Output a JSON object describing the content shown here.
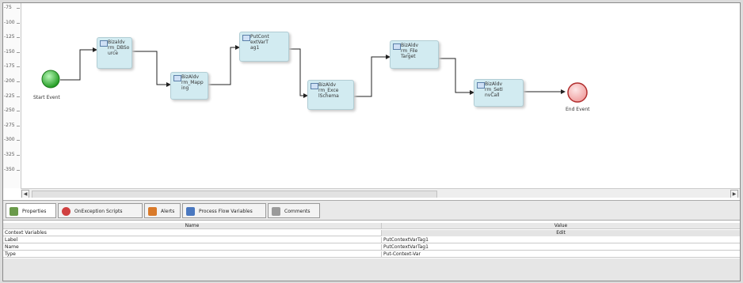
{
  "ruler": {
    "ticks": [
      "-75",
      "-100",
      "-125",
      "-150",
      "-175",
      "-200",
      "-225",
      "-250",
      "-275",
      "-300",
      "-325",
      "-350"
    ]
  },
  "flow": {
    "start_label": "Start Event",
    "end_label": "End Event",
    "nodes": [
      {
        "id": "n1",
        "text": "Bizaldv\nrm_DBSo\nurce",
        "icon": "db-source-icon"
      },
      {
        "id": "n2",
        "text": "BizAldv\nrm_Mapp\ning",
        "icon": "mapping-icon"
      },
      {
        "id": "n3",
        "text": "PutCont\nextVarT\nag1",
        "icon": "put-context-var-icon"
      },
      {
        "id": "n4",
        "text": "BizAldv\nrm_Exce\nlSchema",
        "icon": "excel-schema-icon"
      },
      {
        "id": "n5",
        "text": "BizAldv\nrm_File\nTarget",
        "icon": "file-target-icon"
      },
      {
        "id": "n6",
        "text": "BizAldv\nrm_SetI\nnvCall",
        "icon": "set-inv-call-icon"
      }
    ]
  },
  "tabs": [
    {
      "label": "Properties",
      "active": true,
      "icon": "properties-icon",
      "color": "#6a9a4a"
    },
    {
      "label": "OnException Scripts",
      "active": false,
      "icon": "exception-script-icon",
      "color": "#d04040"
    },
    {
      "label": "Alerts",
      "active": false,
      "icon": "alerts-icon",
      "color": "#d97a2a"
    },
    {
      "label": "Process Flow Variables",
      "active": false,
      "icon": "process-variables-icon",
      "color": "#4a78c0"
    },
    {
      "label": "Comments",
      "active": false,
      "icon": "comments-icon",
      "color": "#9a9a9a"
    }
  ],
  "properties": {
    "col_name": "Name",
    "col_value": "Value",
    "rows": [
      {
        "name": "Context Variables",
        "value": "Edit"
      },
      {
        "name": "Label",
        "value": "PutContextVarTag1"
      },
      {
        "name": "Name",
        "value": "PutContextVarTag1"
      },
      {
        "name": "Type",
        "value": "Put-Context-Var"
      }
    ]
  },
  "colors": {
    "start": "#3fc63f",
    "end": "#f4b4b4",
    "node_fill": "#d2ebf1",
    "accent": "#5b7fa8"
  }
}
